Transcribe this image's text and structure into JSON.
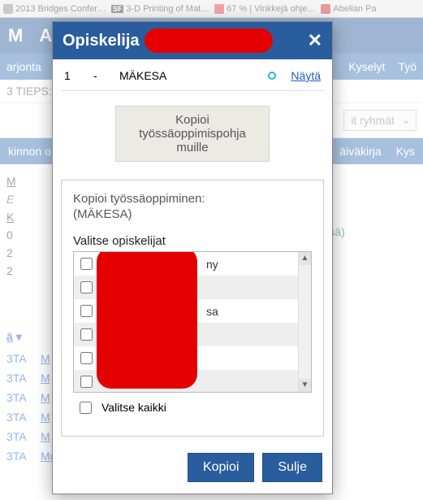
{
  "browser_tabs": [
    {
      "label": "2013 Bridges Confer…"
    },
    {
      "label": "3-D Printing of Mat…",
      "prefix": "SF"
    },
    {
      "label": "67 % | Vinkkejä ohje…"
    },
    {
      "label": "Abelian Pa"
    }
  ],
  "bg": {
    "header_letters": [
      "M",
      "A"
    ],
    "menu1_items": [
      "arjonta",
      "Kyselyt",
      "Työ"
    ],
    "sub_label": "3 TIEPS:",
    "select_label": "it ryhmät",
    "menu2_items": [
      "kinnon o",
      "äiväkirja",
      "Kys"
    ],
    "left_heading": "M",
    "left_sub": "E",
    "left_k": "K",
    "left_nums": [
      "0",
      "2",
      "2"
    ],
    "green_text": "lämässä)",
    "side_label": "ä",
    "table_rows": [
      {
        "code": "3TA",
        "act": "M"
      },
      {
        "code": "3TA",
        "act": "M"
      },
      {
        "code": "3TA",
        "act": "M"
      },
      {
        "code": "3TA",
        "act": "M"
      },
      {
        "code": "3TA",
        "act": "M"
      },
      {
        "code": "3TA",
        "act": "Muokkaa"
      }
    ]
  },
  "modal": {
    "title": "Opiskelija",
    "close": "✕",
    "top_row": {
      "num": "1",
      "dash": "-",
      "name": "MÄKESA",
      "link": "Näytä"
    },
    "copy_template_btn": "Kopioi työssäoppimispohja muille",
    "panel": {
      "heading1": "Kopioi työssäoppiminen:",
      "heading2": "(MÄKESA)",
      "heading3": "Valitse opiskelijat",
      "visible_row_suffixes": [
        "ny",
        "",
        "sa",
        "",
        "",
        "",
        ""
      ],
      "select_all": "Valitse kaikki"
    },
    "footer": {
      "copy": "Kopioi",
      "close": "Sulje"
    }
  }
}
